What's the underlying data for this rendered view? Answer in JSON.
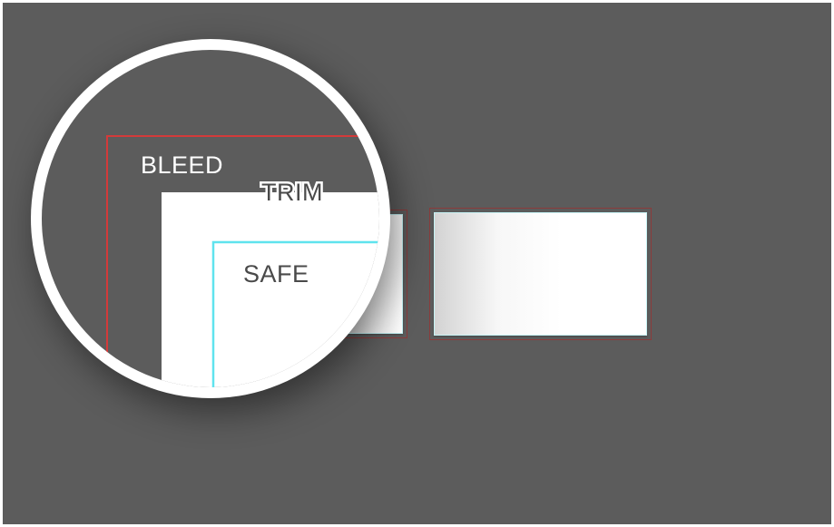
{
  "labels": {
    "bleed": "BLEED",
    "trim": "TRIM",
    "safe": "SAFE"
  },
  "colors": {
    "background": "#5c5c5c",
    "bleed_line": "#d33a3a",
    "trim_area": "#ffffff",
    "safe_line": "#5fe3ee",
    "magnifier_ring": "#ffffff"
  }
}
